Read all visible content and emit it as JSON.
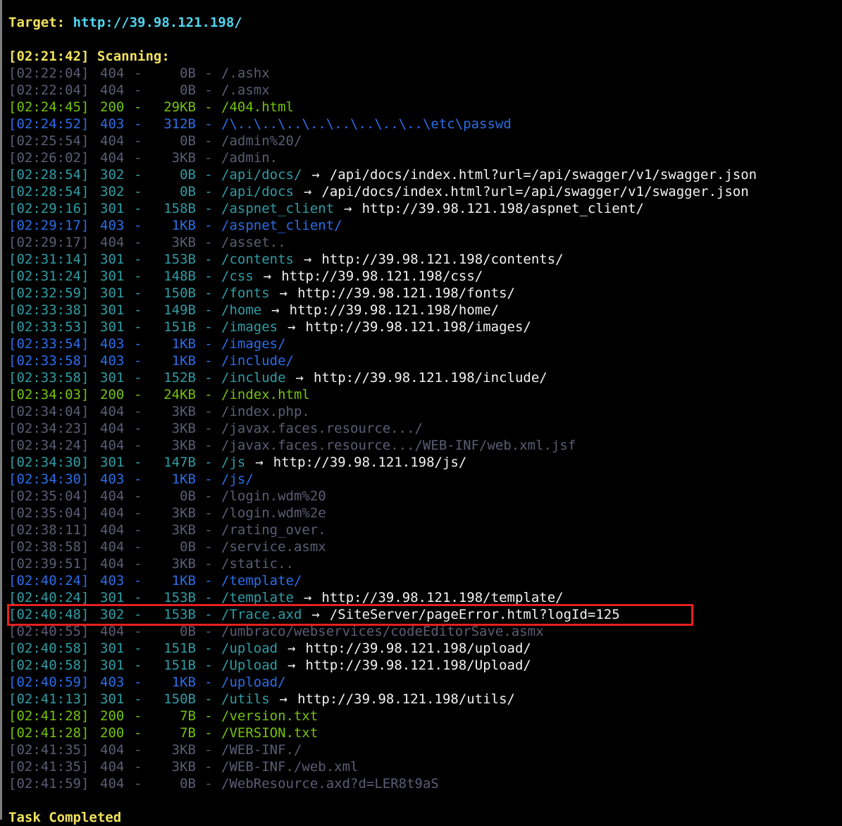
{
  "header": {
    "target_label": "Target:",
    "target_url": "http://39.98.121.198/",
    "scan_time": "[02:21:42]",
    "scan_label": "Scanning:"
  },
  "rows": [
    {
      "time": "[02:22:04]",
      "code": "404",
      "size": "0B",
      "path": "/.ashx",
      "redirect": ""
    },
    {
      "time": "[02:22:04]",
      "code": "404",
      "size": "0B",
      "path": "/.asmx",
      "redirect": ""
    },
    {
      "time": "[02:24:45]",
      "code": "200",
      "size": "29KB",
      "path": "/404.html",
      "redirect": ""
    },
    {
      "time": "[02:24:52]",
      "code": "403",
      "size": "312B",
      "path": "/\\..\\..\\..\\..\\..\\..\\..\\..\\etc\\passwd",
      "redirect": ""
    },
    {
      "time": "[02:25:54]",
      "code": "404",
      "size": "0B",
      "path": "/admin%20/",
      "redirect": ""
    },
    {
      "time": "[02:26:02]",
      "code": "404",
      "size": "3KB",
      "path": "/admin.",
      "redirect": ""
    },
    {
      "time": "[02:28:54]",
      "code": "302",
      "size": "0B",
      "path": "/api/docs/",
      "redirect": "/api/docs/index.html?url=/api/swagger/v1/swagger.json"
    },
    {
      "time": "[02:28:54]",
      "code": "302",
      "size": "0B",
      "path": "/api/docs",
      "redirect": "/api/docs/index.html?url=/api/swagger/v1/swagger.json"
    },
    {
      "time": "[02:29:16]",
      "code": "301",
      "size": "158B",
      "path": "/aspnet_client",
      "redirect": "http://39.98.121.198/aspnet_client/"
    },
    {
      "time": "[02:29:17]",
      "code": "403",
      "size": "1KB",
      "path": "/aspnet_client/",
      "redirect": ""
    },
    {
      "time": "[02:29:17]",
      "code": "404",
      "size": "3KB",
      "path": "/asset..",
      "redirect": ""
    },
    {
      "time": "[02:31:14]",
      "code": "301",
      "size": "153B",
      "path": "/contents",
      "redirect": "http://39.98.121.198/contents/"
    },
    {
      "time": "[02:31:24]",
      "code": "301",
      "size": "148B",
      "path": "/css",
      "redirect": "http://39.98.121.198/css/"
    },
    {
      "time": "[02:32:59]",
      "code": "301",
      "size": "150B",
      "path": "/fonts",
      "redirect": "http://39.98.121.198/fonts/"
    },
    {
      "time": "[02:33:38]",
      "code": "301",
      "size": "149B",
      "path": "/home",
      "redirect": "http://39.98.121.198/home/"
    },
    {
      "time": "[02:33:53]",
      "code": "301",
      "size": "151B",
      "path": "/images",
      "redirect": "http://39.98.121.198/images/"
    },
    {
      "time": "[02:33:54]",
      "code": "403",
      "size": "1KB",
      "path": "/images/",
      "redirect": ""
    },
    {
      "time": "[02:33:58]",
      "code": "403",
      "size": "1KB",
      "path": "/include/",
      "redirect": ""
    },
    {
      "time": "[02:33:58]",
      "code": "301",
      "size": "152B",
      "path": "/include",
      "redirect": "http://39.98.121.198/include/"
    },
    {
      "time": "[02:34:03]",
      "code": "200",
      "size": "24KB",
      "path": "/index.html",
      "redirect": ""
    },
    {
      "time": "[02:34:04]",
      "code": "404",
      "size": "3KB",
      "path": "/index.php.",
      "redirect": ""
    },
    {
      "time": "[02:34:23]",
      "code": "404",
      "size": "3KB",
      "path": "/javax.faces.resource.../",
      "redirect": ""
    },
    {
      "time": "[02:34:24]",
      "code": "404",
      "size": "3KB",
      "path": "/javax.faces.resource.../WEB-INF/web.xml.jsf",
      "redirect": ""
    },
    {
      "time": "[02:34:30]",
      "code": "301",
      "size": "147B",
      "path": "/js",
      "redirect": "http://39.98.121.198/js/"
    },
    {
      "time": "[02:34:30]",
      "code": "403",
      "size": "1KB",
      "path": "/js/",
      "redirect": ""
    },
    {
      "time": "[02:35:04]",
      "code": "404",
      "size": "0B",
      "path": "/login.wdm%20",
      "redirect": ""
    },
    {
      "time": "[02:35:04]",
      "code": "404",
      "size": "3KB",
      "path": "/login.wdm%2e",
      "redirect": ""
    },
    {
      "time": "[02:38:11]",
      "code": "404",
      "size": "3KB",
      "path": "/rating_over.",
      "redirect": ""
    },
    {
      "time": "[02:38:58]",
      "code": "404",
      "size": "0B",
      "path": "/service.asmx",
      "redirect": ""
    },
    {
      "time": "[02:39:51]",
      "code": "404",
      "size": "3KB",
      "path": "/static..",
      "redirect": ""
    },
    {
      "time": "[02:40:24]",
      "code": "403",
      "size": "1KB",
      "path": "/template/",
      "redirect": ""
    },
    {
      "time": "[02:40:24]",
      "code": "301",
      "size": "153B",
      "path": "/template",
      "redirect": "http://39.98.121.198/template/"
    },
    {
      "time": "[02:40:48]",
      "code": "302",
      "size": "153B",
      "path": "/Trace.axd",
      "redirect": "/SiteServer/pageError.html?logId=125"
    },
    {
      "time": "[02:40:55]",
      "code": "404",
      "size": "0B",
      "path": "/umbraco/webservices/codeEditorSave.asmx",
      "redirect": ""
    },
    {
      "time": "[02:40:58]",
      "code": "301",
      "size": "151B",
      "path": "/upload",
      "redirect": "http://39.98.121.198/upload/"
    },
    {
      "time": "[02:40:58]",
      "code": "301",
      "size": "151B",
      "path": "/Upload",
      "redirect": "http://39.98.121.198/Upload/"
    },
    {
      "time": "[02:40:59]",
      "code": "403",
      "size": "1KB",
      "path": "/upload/",
      "redirect": ""
    },
    {
      "time": "[02:41:13]",
      "code": "301",
      "size": "150B",
      "path": "/utils",
      "redirect": "http://39.98.121.198/utils/"
    },
    {
      "time": "[02:41:28]",
      "code": "200",
      "size": "7B",
      "path": "/version.txt",
      "redirect": ""
    },
    {
      "time": "[02:41:28]",
      "code": "200",
      "size": "7B",
      "path": "/VERSION.txt",
      "redirect": ""
    },
    {
      "time": "[02:41:35]",
      "code": "404",
      "size": "3KB",
      "path": "/WEB-INF./",
      "redirect": ""
    },
    {
      "time": "[02:41:35]",
      "code": "404",
      "size": "3KB",
      "path": "/WEB-INF./web.xml",
      "redirect": ""
    },
    {
      "time": "[02:41:59]",
      "code": "404",
      "size": "0B",
      "path": "/WebResource.axd?d=LER8t9aS",
      "redirect": ""
    }
  ],
  "separator_dash": "-",
  "arrow": "→",
  "footer": {
    "status": "Task Completed"
  },
  "highlight": {
    "color": "#e5201e",
    "row_path": "/Trace.axd"
  },
  "colors": {
    "header_yellow": "#f2e25c",
    "url_cyan": "#4fd5ef",
    "status_404": "#5c5c76",
    "status_200": "#74c20c",
    "status_403": "#2a6ee8",
    "status_30x": "#2f9da6",
    "redirect_white": "#f2f2f2"
  }
}
